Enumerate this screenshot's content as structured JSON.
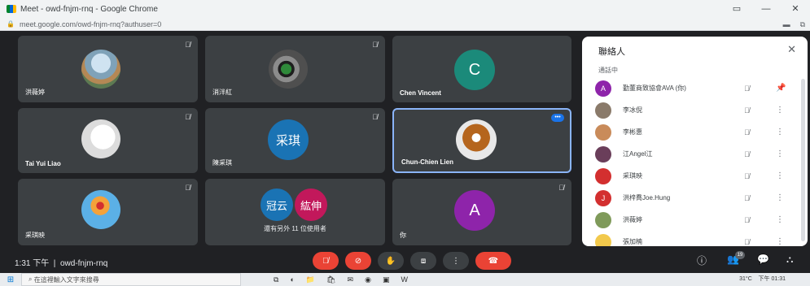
{
  "browser": {
    "window_title": "Meet - owd-fnjm-rnq - Google Chrome",
    "url": "meet.google.com/owd-fnjm-rnq?authuser=0",
    "window_controls": [
      "▭",
      "—",
      "✕"
    ]
  },
  "tiles": [
    {
      "name": "洪薇婷",
      "avatar_text": "",
      "icon": "landscape-photo"
    },
    {
      "name": "消泮紅",
      "avatar_text": "",
      "icon": "face-photo"
    },
    {
      "name": "Chen Vincent",
      "avatar_text": "C",
      "color": "#1b8a7a"
    },
    {
      "name": "Tai Yui Liao",
      "avatar_text": "",
      "icon": "sketch-photo"
    },
    {
      "name": "陳采琪",
      "avatar_text": "采琪",
      "color": "#1a73b4"
    },
    {
      "name": "Chun-Chien Lien",
      "avatar_text": "",
      "icon": "gingerbread-photo"
    },
    {
      "name": "采琪映",
      "avatar_text": "",
      "icon": "bird-photo"
    },
    {
      "name": "",
      "avatar_text": "",
      "others": "還有另外 11 位使用者",
      "avatars": [
        {
          "text": "冠云",
          "color": "#1a73b4"
        },
        {
          "text": "紘伸",
          "color": "#c2185b"
        }
      ]
    },
    {
      "name": "你",
      "avatar_text": "A",
      "color": "#8e24aa"
    }
  ],
  "panel": {
    "title": "聯絡人",
    "section": "通話中",
    "participants": [
      {
        "name": "勤董商致協會AVA (你)",
        "avatar_text": "A",
        "color": "#8e24aa",
        "action": "pin"
      },
      {
        "name": "李冰倪",
        "avatar_text": "",
        "color": "#8a7a6a",
        "action": "more"
      },
      {
        "name": "李彬惠",
        "avatar_text": "",
        "color": "#c98b5a",
        "action": "more"
      },
      {
        "name": "江Angel江",
        "avatar_text": "",
        "color": "#6a3e5a",
        "action": "more"
      },
      {
        "name": "采琪映",
        "avatar_text": "",
        "color": "#d32f2f",
        "action": "more"
      },
      {
        "name": "洪梓喬Joe.Hung",
        "avatar_text": "J",
        "color": "#d32f2f",
        "action": "more"
      },
      {
        "name": "洪薇婷",
        "avatar_text": "",
        "color": "#7f9a5a",
        "action": "more"
      },
      {
        "name": "張加楠",
        "avatar_text": "",
        "color": "#f2c94c",
        "action": "more"
      }
    ]
  },
  "bottom": {
    "time": "1:31 下午",
    "meeting_code": "owd-fnjm-rnq",
    "participant_count": "19"
  },
  "taskbar": {
    "search_placeholder": "在這裡輸入文字來搜尋",
    "temperature": "31°C",
    "clock": "下午 01:31"
  }
}
